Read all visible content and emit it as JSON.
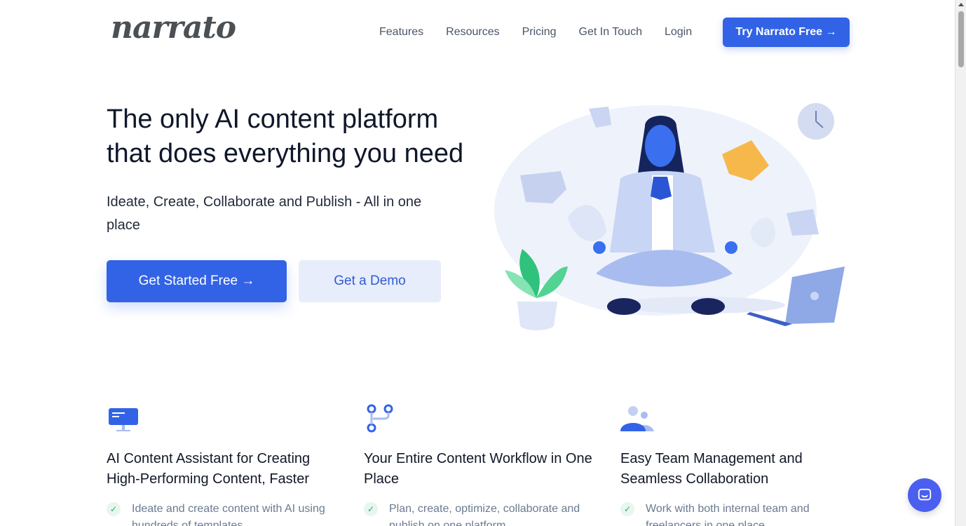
{
  "header": {
    "logo": "narrato",
    "nav": [
      "Features",
      "Resources",
      "Pricing",
      "Get In Touch",
      "Login"
    ],
    "cta": "Try Narrato Free →"
  },
  "hero": {
    "title_line1": "The only AI content platform",
    "title_line2": "that does everything you need",
    "subtitle": "Ideate, Create, Collaborate and Publish - All in one place",
    "primary_button": "Get Started Free →",
    "secondary_button": "Get a Demo"
  },
  "features": [
    {
      "icon": "monitor-icon",
      "title": "AI Content Assistant for Creating High-Performing Content, Faster",
      "item": "Ideate and create content with AI using hundreds of templates"
    },
    {
      "icon": "workflow-icon",
      "title": "Your Entire Content Workflow in One Place",
      "item": "Plan, create, optimize, collaborate and publish on one platform"
    },
    {
      "icon": "team-icon",
      "title": "Easy Team Management and Seamless Collaboration",
      "item": "Work with both internal team and freelancers in one place"
    }
  ],
  "colors": {
    "primary": "#3263e6",
    "secondary_bg": "#e8edfb",
    "check": "#2fa86a",
    "chat": "#4a5ff0"
  }
}
